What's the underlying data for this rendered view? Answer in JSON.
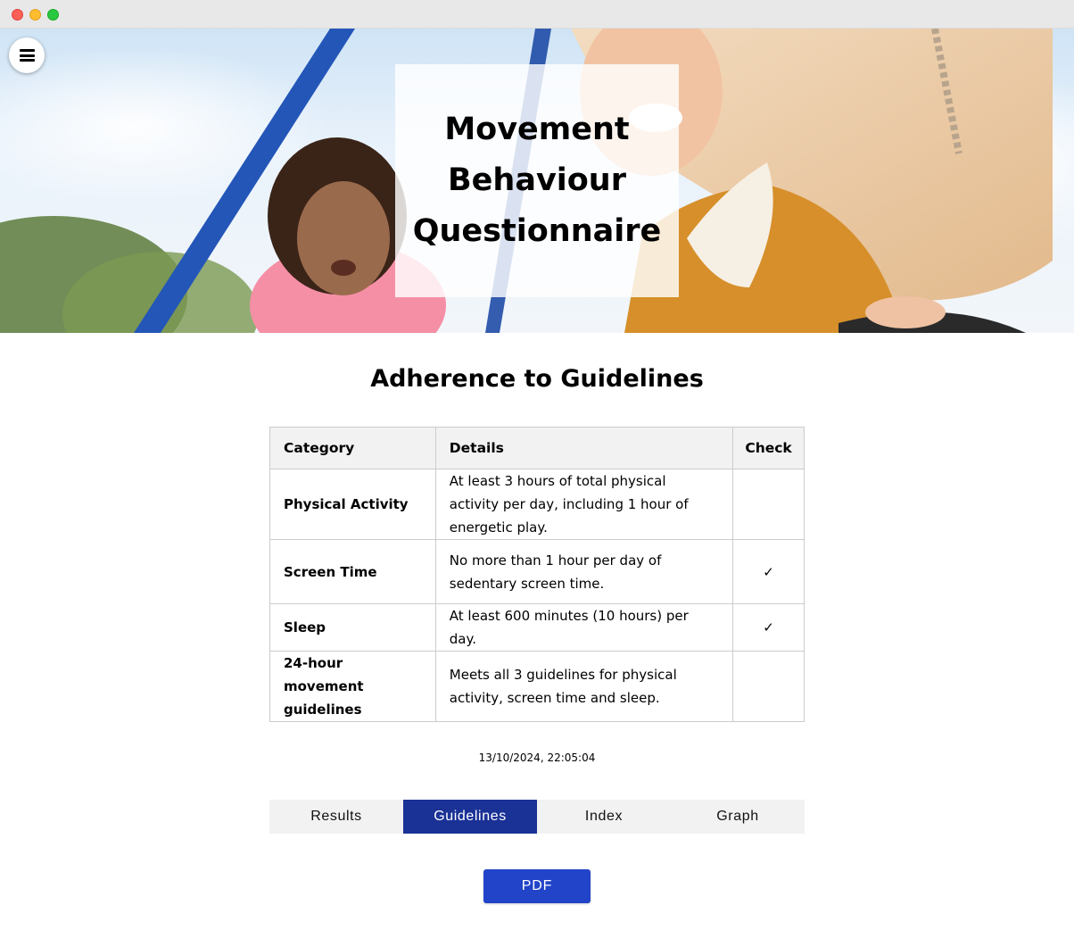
{
  "hero": {
    "title": "Movement Behaviour Questionnaire",
    "menu_icon": "hamburger-menu-icon"
  },
  "section": {
    "heading": "Adherence to Guidelines"
  },
  "table": {
    "headers": {
      "category": "Category",
      "details": "Details",
      "check": "Check"
    },
    "rows": [
      {
        "category": "Physical Activity",
        "details": "At least 3 hours of total physical activity per day, including 1 hour of energetic play.",
        "check": ""
      },
      {
        "category": "Screen Time",
        "details": "No more than 1 hour per day of sedentary screen time.",
        "check": "✓"
      },
      {
        "category": "Sleep",
        "details": "At least 600 minutes (10 hours) per day.",
        "check": "✓"
      },
      {
        "category": "24-hour movement guidelines",
        "details": "Meets all 3 guidelines for physical activity, screen time and sleep.",
        "check": ""
      }
    ]
  },
  "timestamp": "13/10/2024, 22:05:04",
  "tabs": [
    {
      "label": "Results",
      "active": false
    },
    {
      "label": "Guidelines",
      "active": true
    },
    {
      "label": "Index",
      "active": false
    },
    {
      "label": "Graph",
      "active": false
    }
  ],
  "pdf_button": {
    "label": "PDF"
  },
  "colors": {
    "active_tab": "#1a3196",
    "pdf_button": "#2244c9",
    "tab_background": "#f2f2f2",
    "table_header_background": "#f2f2f2"
  }
}
